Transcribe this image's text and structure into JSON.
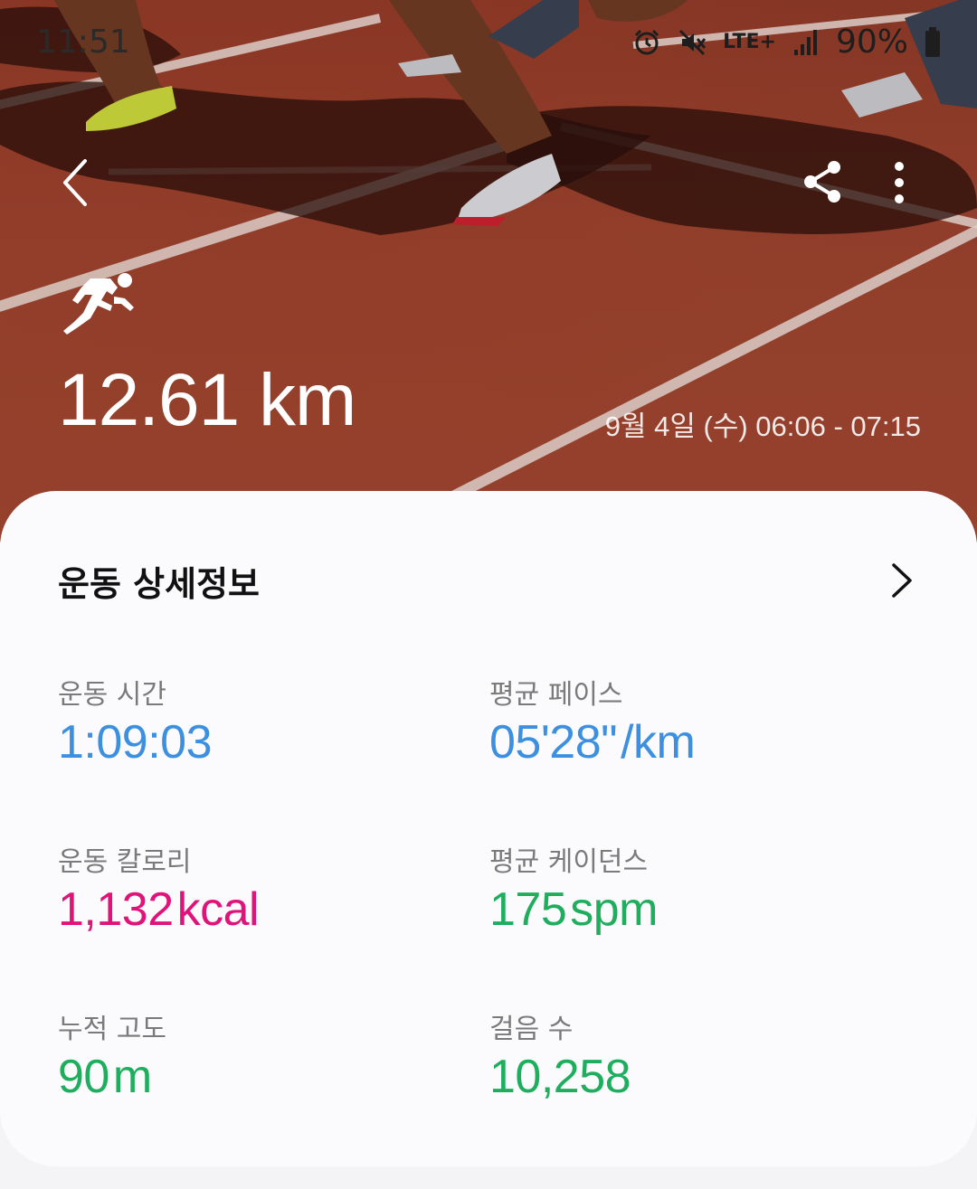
{
  "status_bar": {
    "time": "11:51",
    "network": "LTE+",
    "battery": "90%",
    "icons": [
      "alarm-icon",
      "mute-icon",
      "lte-icon",
      "signal-icon",
      "battery-icon"
    ]
  },
  "header": {
    "back_icon": "chevron-left-icon",
    "share_icon": "share-icon",
    "more_icon": "more-vertical-icon"
  },
  "workout": {
    "activity_icon": "running-icon",
    "distance": "12.61 km",
    "date_range": "9월 4일 (수) 06:06 - 07:15"
  },
  "details": {
    "title": "운동 상세정보",
    "stats": [
      {
        "label": "운동 시간",
        "value": "1:09:03",
        "unit": "",
        "color": "#3d8fe0"
      },
      {
        "label": "평균 페이스",
        "value": "05'28\"",
        "unit": "/km",
        "color": "#3d8fe0"
      },
      {
        "label": "운동 칼로리",
        "value": "1,132",
        "unit": "kcal",
        "color": "#e0137a"
      },
      {
        "label": "평균 케이던스",
        "value": "175",
        "unit": "spm",
        "color": "#1fae5e"
      },
      {
        "label": "누적 고도",
        "value": "90",
        "unit": "m",
        "color": "#1fae5e"
      },
      {
        "label": "걸음 수",
        "value": "10,258",
        "unit": "",
        "color": "#1fae5e"
      }
    ]
  },
  "colors": {
    "track": "#9a422e",
    "card_bg": "#fbfbfd",
    "blue": "#3d8fe0",
    "pink": "#e0137a",
    "green": "#1fae5e"
  }
}
